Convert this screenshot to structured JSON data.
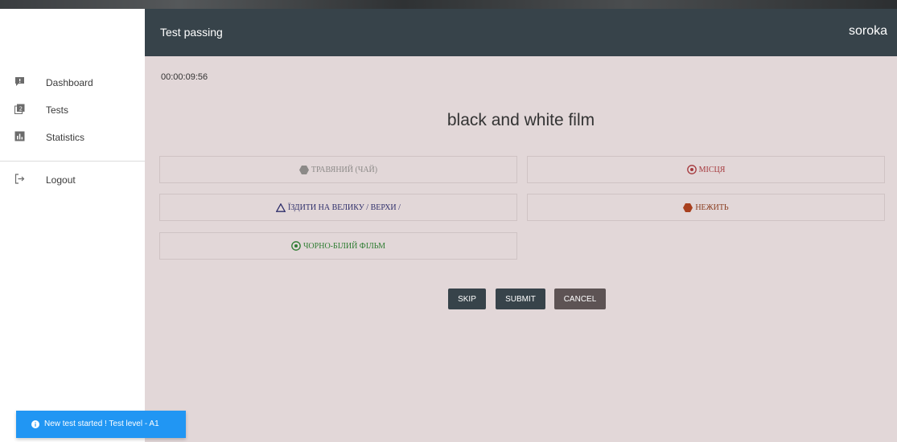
{
  "header": {
    "title": "Test passing",
    "user": "soroka"
  },
  "sidebar": {
    "items": [
      {
        "label": "Dashboard",
        "icon": "dashboard-icon"
      },
      {
        "label": "Tests",
        "icon": "tests-icon"
      },
      {
        "label": "Statistics",
        "icon": "statistics-icon"
      }
    ],
    "logout": {
      "label": "Logout",
      "icon": "logout-icon"
    }
  },
  "main": {
    "timer": "00:00:09:56",
    "question": "black and white film",
    "answers": [
      {
        "label": "ТРАВЯНИЙ (ЧАЙ)",
        "icon": "hexagon-icon",
        "color": "#8c8a88"
      },
      {
        "label": "МІСЦЯ",
        "icon": "target-icon",
        "color": "#a5383c"
      },
      {
        "label": "ЇЗДИТИ НА ВЕЛИКУ / ВЕРХИ /",
        "icon": "triangle-icon",
        "color": "#2f2f6b"
      },
      {
        "label": "НЕЖИТЬ",
        "icon": "hexagon-icon",
        "color": "#8a3d1f"
      },
      {
        "label": "ЧОРНО-БІЛИЙ ФІЛЬМ",
        "icon": "target-icon",
        "color": "#2e7d32"
      }
    ],
    "buttons": {
      "skip": "SKIP",
      "submit": "SUBMIT",
      "cancel": "CANCEL"
    }
  },
  "toast": {
    "message": "New test started ! Test level - A1"
  },
  "colors": {
    "header_bg": "#37434a",
    "main_bg": "#e2d7d8",
    "button_dark": "#37434a",
    "button_cancel": "#5d5354",
    "toast_bg": "#2196f3"
  }
}
